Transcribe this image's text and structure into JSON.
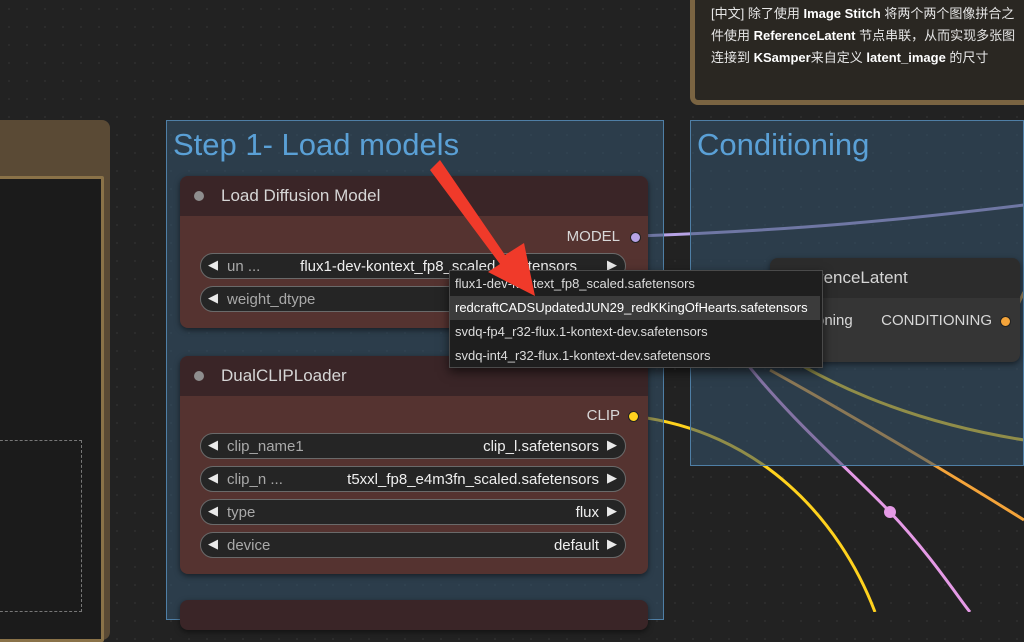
{
  "note": {
    "lines": [
      {
        "a": "[中文] 除了使用 ",
        "b": "Image Stitch",
        "c": " 将两个两个图像拼合之"
      },
      {
        "a": "件使用 ",
        "b": "ReferenceLatent",
        "c": " 节点串联，从而实现多张图"
      },
      {
        "a": "连接到 ",
        "b": "KSamper",
        "c": "来自定义 ",
        "d": "latent_image",
        "e": " 的尺寸"
      }
    ]
  },
  "groups": {
    "load_models_title": "Step 1- Load models",
    "conditioning_title": "Conditioning"
  },
  "nodes": {
    "diffusion": {
      "title": "Load Diffusion Model",
      "output": "MODEL",
      "widgets": [
        {
          "name": "un ...",
          "value": "flux1-dev-kontext_fp8_scaled.safetensors"
        },
        {
          "name": "weight_dtype",
          "value": ""
        }
      ]
    },
    "clip": {
      "title": "DualCLIPLoader",
      "output": "CLIP",
      "widgets": [
        {
          "name": "clip_name1",
          "value": "clip_l.safetensors"
        },
        {
          "name": "clip_n ...",
          "value": "t5xxl_fp8_e4m3fn_scaled.safetensors"
        },
        {
          "name": "type",
          "value": "flux"
        },
        {
          "name": "device",
          "value": "default"
        }
      ]
    },
    "reference_latent": {
      "title": "ReferenceLatent",
      "input_label": "oning",
      "output": "CONDITIONING"
    }
  },
  "dropdown": {
    "items": [
      "flux1-dev-kontext_fp8_scaled.safetensors",
      "redcraftCADSUpdatedJUN29_redKKingOfHearts.safetensors",
      "svdq-fp4_r32-flux.1-kontext-dev.safetensors",
      "svdq-int4_r32-flux.1-kontext-dev.safetensors"
    ],
    "highlighted_index": 1
  },
  "icons": {
    "arrow_left": "◀",
    "arrow_right": "▶"
  },
  "colors": {
    "model_link": "#b7a3e6",
    "clip_link": "#ffd21e",
    "conditioning_link": "#f4a43a",
    "pink_link": "#e59ae6",
    "group_title": "#5aa0d6",
    "annotation_arrow": "#f03a2a"
  }
}
